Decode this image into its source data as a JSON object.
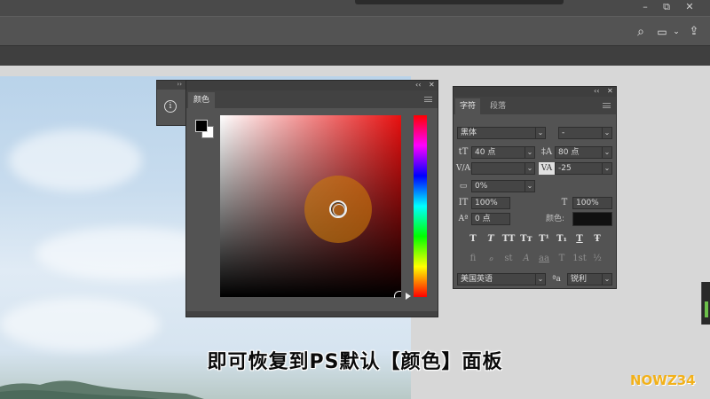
{
  "window": {
    "minimize": "–",
    "restore": "⧉",
    "close": "✕"
  },
  "optionsbar": {
    "search": "⌕",
    "workspace": "▭",
    "workspace_dd": "⌄",
    "share": "⇪"
  },
  "info_dock": {
    "collapse": "››",
    "icon": "i"
  },
  "color_panel": {
    "collapse": "‹‹",
    "close": "✕",
    "tab": "颜色",
    "colors": {
      "hue": "#e81010",
      "picker_halo": "#c8780a",
      "foreground": "#000000",
      "background": "#ffffff"
    }
  },
  "character_panel": {
    "collapse": "‹‹",
    "close": "✕",
    "tabs": [
      "字符",
      "段落"
    ],
    "font_family": "黑体",
    "font_style": "-",
    "font_size": "40 点",
    "leading": "80 点",
    "kerning": "",
    "tracking": "-25",
    "scale_shift": "0%",
    "vertical_scale": "100%",
    "horizontal_scale": "100%",
    "baseline_shift": "0 点",
    "color_label": "颜色:",
    "color_value": "#101010",
    "style_buttons": [
      "T",
      "T",
      "TT",
      "Tт",
      "T¹",
      "T₁",
      "T",
      "Ŧ"
    ],
    "opentype_buttons": [
      "ﬁ",
      "ℴ",
      "st",
      "A",
      "aa",
      "T",
      "1st",
      "½"
    ],
    "language": "美国英语",
    "aa_icon": "ªa",
    "antialias": "锐利",
    "labels": {
      "size": "tT",
      "leading": "‡A",
      "kerning": "V/A",
      "tracking": "VA",
      "tsume": "▭",
      "vscale": "IT",
      "hscale": "T",
      "baseline": "Aª"
    }
  },
  "subtitle": "即可恢复到PS默认【颜色】面板",
  "watermark": "NOWZ34"
}
